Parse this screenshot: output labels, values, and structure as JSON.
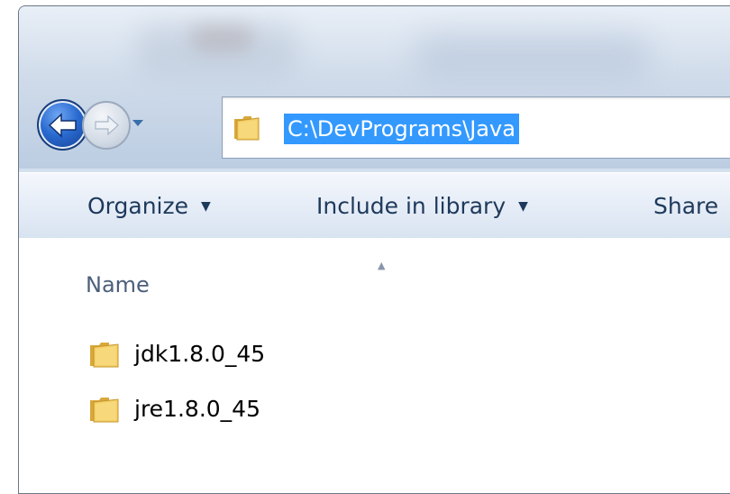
{
  "address_bar": {
    "path": "C:\\DevPrograms\\Java",
    "folder_icon": "folder-icon"
  },
  "navigation": {
    "back_icon": "back-arrow-icon",
    "forward_icon": "forward-arrow-icon",
    "recent_icon": "chevron-down-icon"
  },
  "toolbar": {
    "organize_label": "Organize",
    "include_label": "Include in library",
    "share_label": "Share"
  },
  "file_list": {
    "column_header": "Name",
    "items": [
      {
        "name": "jdk1.8.0_45",
        "icon": "folder-icon"
      },
      {
        "name": "jre1.8.0_45",
        "icon": "folder-icon"
      }
    ]
  },
  "colors": {
    "selection": "#3399ff",
    "toolbar_text": "#1e395b",
    "back_button": "#2a6bd1"
  }
}
